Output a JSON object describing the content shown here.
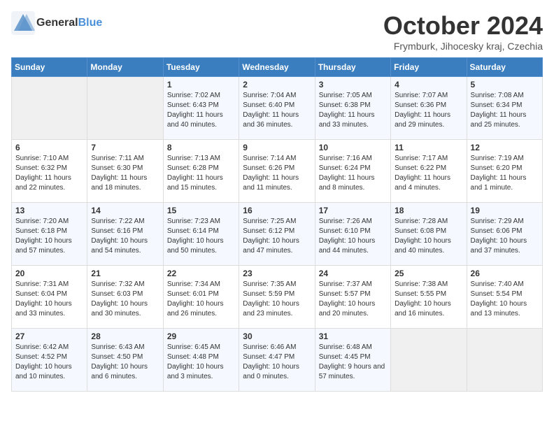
{
  "logo": {
    "text_general": "General",
    "text_blue": "Blue"
  },
  "title": "October 2024",
  "subtitle": "Frymburk, Jihocesky kraj, Czechia",
  "days_of_week": [
    "Sunday",
    "Monday",
    "Tuesday",
    "Wednesday",
    "Thursday",
    "Friday",
    "Saturday"
  ],
  "weeks": [
    [
      {
        "day": "",
        "empty": true
      },
      {
        "day": "",
        "empty": true
      },
      {
        "day": "1",
        "sunrise": "Sunrise: 7:02 AM",
        "sunset": "Sunset: 6:43 PM",
        "daylight": "Daylight: 11 hours and 40 minutes."
      },
      {
        "day": "2",
        "sunrise": "Sunrise: 7:04 AM",
        "sunset": "Sunset: 6:40 PM",
        "daylight": "Daylight: 11 hours and 36 minutes."
      },
      {
        "day": "3",
        "sunrise": "Sunrise: 7:05 AM",
        "sunset": "Sunset: 6:38 PM",
        "daylight": "Daylight: 11 hours and 33 minutes."
      },
      {
        "day": "4",
        "sunrise": "Sunrise: 7:07 AM",
        "sunset": "Sunset: 6:36 PM",
        "daylight": "Daylight: 11 hours and 29 minutes."
      },
      {
        "day": "5",
        "sunrise": "Sunrise: 7:08 AM",
        "sunset": "Sunset: 6:34 PM",
        "daylight": "Daylight: 11 hours and 25 minutes."
      }
    ],
    [
      {
        "day": "6",
        "sunrise": "Sunrise: 7:10 AM",
        "sunset": "Sunset: 6:32 PM",
        "daylight": "Daylight: 11 hours and 22 minutes."
      },
      {
        "day": "7",
        "sunrise": "Sunrise: 7:11 AM",
        "sunset": "Sunset: 6:30 PM",
        "daylight": "Daylight: 11 hours and 18 minutes."
      },
      {
        "day": "8",
        "sunrise": "Sunrise: 7:13 AM",
        "sunset": "Sunset: 6:28 PM",
        "daylight": "Daylight: 11 hours and 15 minutes."
      },
      {
        "day": "9",
        "sunrise": "Sunrise: 7:14 AM",
        "sunset": "Sunset: 6:26 PM",
        "daylight": "Daylight: 11 hours and 11 minutes."
      },
      {
        "day": "10",
        "sunrise": "Sunrise: 7:16 AM",
        "sunset": "Sunset: 6:24 PM",
        "daylight": "Daylight: 11 hours and 8 minutes."
      },
      {
        "day": "11",
        "sunrise": "Sunrise: 7:17 AM",
        "sunset": "Sunset: 6:22 PM",
        "daylight": "Daylight: 11 hours and 4 minutes."
      },
      {
        "day": "12",
        "sunrise": "Sunrise: 7:19 AM",
        "sunset": "Sunset: 6:20 PM",
        "daylight": "Daylight: 11 hours and 1 minute."
      }
    ],
    [
      {
        "day": "13",
        "sunrise": "Sunrise: 7:20 AM",
        "sunset": "Sunset: 6:18 PM",
        "daylight": "Daylight: 10 hours and 57 minutes."
      },
      {
        "day": "14",
        "sunrise": "Sunrise: 7:22 AM",
        "sunset": "Sunset: 6:16 PM",
        "daylight": "Daylight: 10 hours and 54 minutes."
      },
      {
        "day": "15",
        "sunrise": "Sunrise: 7:23 AM",
        "sunset": "Sunset: 6:14 PM",
        "daylight": "Daylight: 10 hours and 50 minutes."
      },
      {
        "day": "16",
        "sunrise": "Sunrise: 7:25 AM",
        "sunset": "Sunset: 6:12 PM",
        "daylight": "Daylight: 10 hours and 47 minutes."
      },
      {
        "day": "17",
        "sunrise": "Sunrise: 7:26 AM",
        "sunset": "Sunset: 6:10 PM",
        "daylight": "Daylight: 10 hours and 44 minutes."
      },
      {
        "day": "18",
        "sunrise": "Sunrise: 7:28 AM",
        "sunset": "Sunset: 6:08 PM",
        "daylight": "Daylight: 10 hours and 40 minutes."
      },
      {
        "day": "19",
        "sunrise": "Sunrise: 7:29 AM",
        "sunset": "Sunset: 6:06 PM",
        "daylight": "Daylight: 10 hours and 37 minutes."
      }
    ],
    [
      {
        "day": "20",
        "sunrise": "Sunrise: 7:31 AM",
        "sunset": "Sunset: 6:04 PM",
        "daylight": "Daylight: 10 hours and 33 minutes."
      },
      {
        "day": "21",
        "sunrise": "Sunrise: 7:32 AM",
        "sunset": "Sunset: 6:03 PM",
        "daylight": "Daylight: 10 hours and 30 minutes."
      },
      {
        "day": "22",
        "sunrise": "Sunrise: 7:34 AM",
        "sunset": "Sunset: 6:01 PM",
        "daylight": "Daylight: 10 hours and 26 minutes."
      },
      {
        "day": "23",
        "sunrise": "Sunrise: 7:35 AM",
        "sunset": "Sunset: 5:59 PM",
        "daylight": "Daylight: 10 hours and 23 minutes."
      },
      {
        "day": "24",
        "sunrise": "Sunrise: 7:37 AM",
        "sunset": "Sunset: 5:57 PM",
        "daylight": "Daylight: 10 hours and 20 minutes."
      },
      {
        "day": "25",
        "sunrise": "Sunrise: 7:38 AM",
        "sunset": "Sunset: 5:55 PM",
        "daylight": "Daylight: 10 hours and 16 minutes."
      },
      {
        "day": "26",
        "sunrise": "Sunrise: 7:40 AM",
        "sunset": "Sunset: 5:54 PM",
        "daylight": "Daylight: 10 hours and 13 minutes."
      }
    ],
    [
      {
        "day": "27",
        "sunrise": "Sunrise: 6:42 AM",
        "sunset": "Sunset: 4:52 PM",
        "daylight": "Daylight: 10 hours and 10 minutes."
      },
      {
        "day": "28",
        "sunrise": "Sunrise: 6:43 AM",
        "sunset": "Sunset: 4:50 PM",
        "daylight": "Daylight: 10 hours and 6 minutes."
      },
      {
        "day": "29",
        "sunrise": "Sunrise: 6:45 AM",
        "sunset": "Sunset: 4:48 PM",
        "daylight": "Daylight: 10 hours and 3 minutes."
      },
      {
        "day": "30",
        "sunrise": "Sunrise: 6:46 AM",
        "sunset": "Sunset: 4:47 PM",
        "daylight": "Daylight: 10 hours and 0 minutes."
      },
      {
        "day": "31",
        "sunrise": "Sunrise: 6:48 AM",
        "sunset": "Sunset: 4:45 PM",
        "daylight": "Daylight: 9 hours and 57 minutes."
      },
      {
        "day": "",
        "empty": true
      },
      {
        "day": "",
        "empty": true
      }
    ]
  ]
}
